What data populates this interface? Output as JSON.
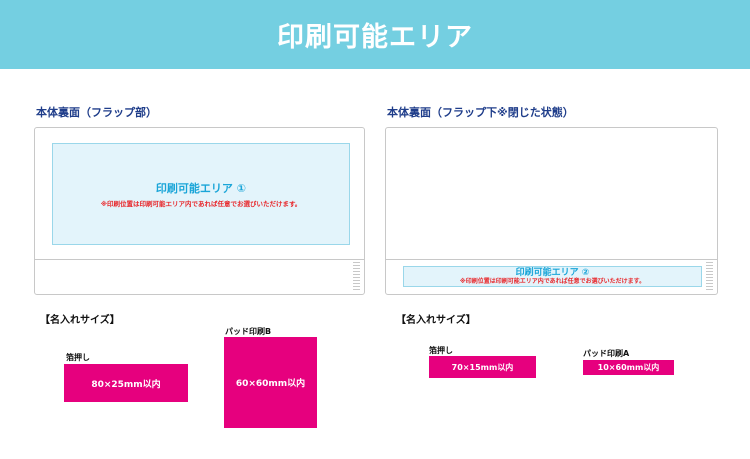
{
  "header": {
    "title": "印刷可能エリア"
  },
  "colors": {
    "banner": "#74cfe1",
    "magenta": "#e6007e",
    "area_fill": "#e3f4fb",
    "area_label": "#1aa5d8",
    "note_red": "#e8262a",
    "title_navy": "#1f3d8a"
  },
  "left": {
    "title": "本体裏面（フラップ部）",
    "area": {
      "label": "印刷可能エリア ①",
      "note": "※印刷位置は印刷可能エリア内であれば任意でお選びいただけます。"
    },
    "sizes": {
      "title": "【名入れサイズ】",
      "items": [
        {
          "label": "箔押し",
          "size": "80×25mm以内"
        },
        {
          "label": "パッド印刷B",
          "size": "60×60mm以内"
        }
      ]
    }
  },
  "right": {
    "title": "本体裏面（フラップ下※閉じた状態）",
    "area": {
      "label": "印刷可能エリア ②",
      "note": "※印刷位置は印刷可能エリア内であれば任意でお選びいただけます。"
    },
    "sizes": {
      "title": "【名入れサイズ】",
      "items": [
        {
          "label": "箔押し",
          "size": "70×15mm以内"
        },
        {
          "label": "パッド印刷A",
          "size": "10×60mm以内"
        }
      ]
    }
  }
}
